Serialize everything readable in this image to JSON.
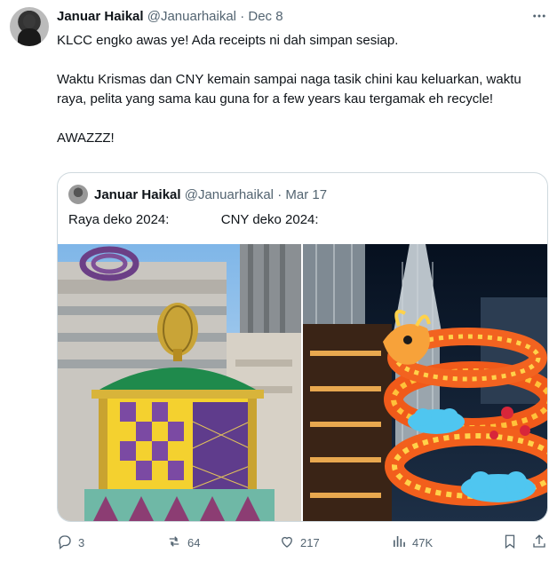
{
  "tweet": {
    "author_name": "Januar Haikal",
    "author_handle": "@Januarhaikal",
    "separator": "·",
    "date": "Dec 8",
    "paragraphs": [
      "KLCC engko awas ye! Ada receipts ni dah simpan sesiap.",
      "Waktu Krismas dan CNY kemain sampai naga tasik chini kau keluarkan, waktu raya, pelita yang sama kau guna for a few years kau tergamak eh recycle!",
      "AWAZZZ!"
    ]
  },
  "quote": {
    "author_name": "Januar Haikal",
    "author_handle": "@Januarhaikal",
    "separator": "·",
    "date": "Mar 17",
    "text": "Raya deko 2024:              CNY deko 2024:"
  },
  "actions": {
    "replies": "3",
    "reposts": "64",
    "likes": "217",
    "views": "47K"
  },
  "icons": {
    "more": "more-icon",
    "reply": "reply-icon",
    "repost": "repost-icon",
    "like": "heart-icon",
    "views": "views-icon",
    "bookmark": "bookmark-icon",
    "share": "share-icon"
  },
  "colors": {
    "text": "#0f1419",
    "muted": "#536471",
    "border": "#cfd9de"
  }
}
